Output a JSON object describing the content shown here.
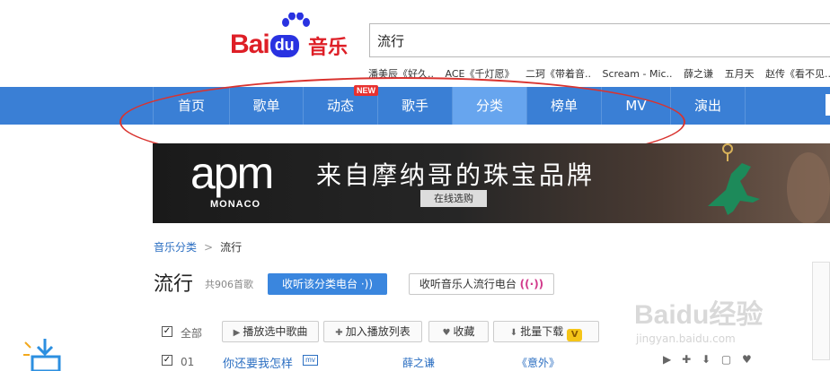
{
  "header": {
    "logo": {
      "bai": "Bai",
      "du": "du",
      "music": "音乐"
    },
    "search": {
      "value": "流行"
    },
    "hot_searches": [
      "潘美辰《好久..",
      "ACE《千灯愿》",
      "二珂《带着音..",
      "Scream - Mic..",
      "薛之谦",
      "五月天",
      "赵传《看不见.."
    ]
  },
  "nav": {
    "items": [
      {
        "label": "首页"
      },
      {
        "label": "歌单"
      },
      {
        "label": "动态"
      },
      {
        "label": "歌手"
      },
      {
        "label": "分类"
      },
      {
        "label": "榜单"
      },
      {
        "label": "MV"
      },
      {
        "label": "演出"
      }
    ],
    "new_badge": "NEW",
    "active_index": 4
  },
  "banner": {
    "brand": "apm",
    "sub": "MONACO",
    "slogan": "来自摩纳哥的珠宝品牌",
    "button": "在线选购"
  },
  "breadcrumb": {
    "parent": "音乐分类",
    "separator": ">",
    "current": "流行"
  },
  "title_row": {
    "title": "流行",
    "count": "共906首歌",
    "radio_button": "收听该分类电台",
    "radio_button_icon": "·))",
    "radio_button2": "收听音乐人流行电台",
    "radio_button2_icon": "((·))"
  },
  "toolbar": {
    "select_all": "全部",
    "play_selected": "播放选中歌曲",
    "add_to_playlist": "加入播放列表",
    "favorite": "收藏",
    "batch_download": "批量下载",
    "vip": "V"
  },
  "songs": [
    {
      "index": "01",
      "title": "你还要我怎样",
      "mv": "mv",
      "artist": "薛之谦",
      "album": "《意外》"
    }
  ],
  "watermark": {
    "text": "Baidu经验",
    "url": "jingyan.baidu.com"
  },
  "colors": {
    "nav": "#3a7fd5",
    "nav_active": "#67a5ee",
    "accent_red": "#d9332f",
    "link": "#2c6fc2"
  }
}
